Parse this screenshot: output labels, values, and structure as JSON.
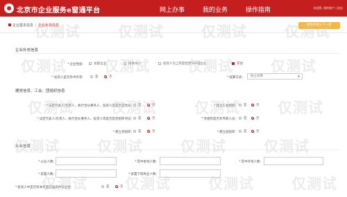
{
  "header": {
    "brand": "北京市企业服务e窗通平台",
    "nav": [
      "网上办事",
      "我的业务",
      "操作指南"
    ],
    "user": "欢迎您, 我的账户 | 退出"
  },
  "breadcrumb": {
    "item1": "企业基本信息",
    "separator": "|",
    "item2": "企业补充信息",
    "action_button": "保存并进入下一步"
  },
  "section1": {
    "title": "企业补充信息",
    "enterprise_nature_label": "企业性质:",
    "nature_options": [
      {
        "label": "总部企业",
        "checked": false
      },
      {
        "label": "研发中心",
        "checked": false
      },
      {
        "label": "投资人为上年度世界500强企业",
        "checked": false
      },
      {
        "label": "其他",
        "checked": true
      }
    ],
    "foreign_investor_label": "投资人是否有中外资:",
    "foreign_investor_options": [
      {
        "label": "是",
        "checked": false
      },
      {
        "label": "否",
        "checked": true
      }
    ],
    "accounting_label": "核算方式:",
    "accounting_value": "独立核算"
  },
  "section2": {
    "title": "建党信息、工会、团组织信息",
    "rows": [
      {
        "label": "法定代表人/负责人、执行合伙事务人、投资人等是否是党员:",
        "options": [
          {
            "label": "是",
            "checked": false
          },
          {
            "label": "否",
            "checked": true
          }
        ],
        "right_label": "建立工会组织:",
        "right_options": [
          {
            "label": "是",
            "checked": false
          },
          {
            "label": "否",
            "checked": true
          }
        ]
      },
      {
        "label": "法定代表人/负责人、执行合伙事务人、投资人等是否是党组织书记:",
        "options": [
          {
            "label": "是",
            "checked": false
          },
          {
            "label": "否",
            "checked": true
          }
        ],
        "right_label": "党组织是否有专职人员:",
        "right_options": [
          {
            "label": "是",
            "checked": false
          },
          {
            "label": "否",
            "checked": true
          }
        ]
      },
      {
        "label": "建立党组织:",
        "options": [
          {
            "label": "是",
            "checked": false
          },
          {
            "label": "否",
            "checked": true
          }
        ],
        "right_label": "建立团组织:",
        "right_options": [
          {
            "label": "是",
            "checked": false
          },
          {
            "label": "否",
            "checked": true
          }
        ]
      }
    ]
  },
  "section3": {
    "title": "从业信息",
    "row1": [
      "从业人数:",
      "其中本地人数:",
      "其中外地人数:"
    ],
    "row2": [
      "安置人数:",
      "安置下岗失业人数:"
    ],
    "graduate_label": "投资人中是否有本年度应届高中毕业生:",
    "graduate_options": [
      {
        "label": "是",
        "checked": false
      },
      {
        "label": "否",
        "checked": true
      }
    ]
  },
  "watermark": "仅测试",
  "colors": {
    "brand": "#c41e1e",
    "accent": "#f4b83e"
  }
}
